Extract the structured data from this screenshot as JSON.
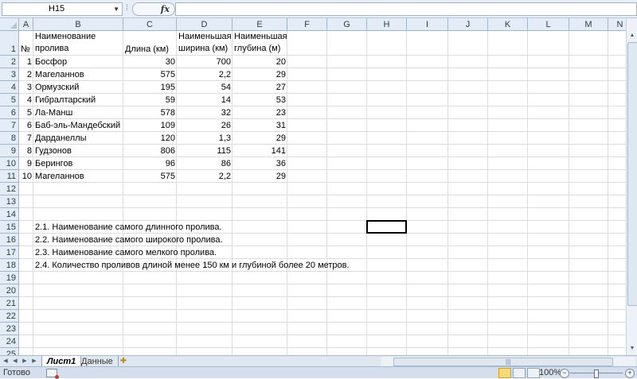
{
  "formula_bar": {
    "name_box": "H15",
    "fx_label": "fx",
    "formula": ""
  },
  "columns": [
    "A",
    "B",
    "C",
    "D",
    "E",
    "F",
    "G",
    "H",
    "I",
    "J",
    "K",
    "L",
    "M",
    "N"
  ],
  "header_row": {
    "a": "№",
    "b": "Наименование пролива",
    "c": "Длина (км)",
    "d": "Наименьшая ширина (км)",
    "e": "Наименьшая глубина (м)"
  },
  "rows": [
    {
      "a": "1",
      "b": "Босфор",
      "c": "30",
      "d": "700",
      "e": "20"
    },
    {
      "a": "2",
      "b": "Магеланнов",
      "c": "575",
      "d": "2,2",
      "e": "29"
    },
    {
      "a": "3",
      "b": "Ормузский",
      "c": "195",
      "d": "54",
      "e": "27"
    },
    {
      "a": "4",
      "b": "Гибралтарский",
      "c": "59",
      "d": "14",
      "e": "53"
    },
    {
      "a": "5",
      "b": "Ла-Манш",
      "c": "578",
      "d": "32",
      "e": "23"
    },
    {
      "a": "6",
      "b": "Баб-эль-Мандебский",
      "c": "109",
      "d": "26",
      "e": "31"
    },
    {
      "a": "7",
      "b": "Дарданеллы",
      "c": "120",
      "d": "1,3",
      "e": "29"
    },
    {
      "a": "8",
      "b": "Гудзонов",
      "c": "806",
      "d": "115",
      "e": "141"
    },
    {
      "a": "9",
      "b": "Берингов",
      "c": "96",
      "d": "86",
      "e": "36"
    },
    {
      "a": "10",
      "b": "Магеланнов",
      "c": "575",
      "d": "2,2",
      "e": "29"
    }
  ],
  "tasks": [
    "2.1. Наименование самого длинного пролива.",
    "2.2. Наименование самого широкого пролива.",
    "2.3. Наименование самого мелкого пролива.",
    "2.4. Количество проливов длиной менее 150 км и глубиной более 20 метров."
  ],
  "row_numbers": [
    "1",
    "2",
    "3",
    "4",
    "5",
    "6",
    "7",
    "8",
    "9",
    "10",
    "11",
    "12",
    "13",
    "14",
    "15",
    "16",
    "17",
    "18",
    "19",
    "20",
    "21",
    "22",
    "23",
    "24",
    "25"
  ],
  "sheet_tabs": [
    "Лист1",
    "Данные"
  ],
  "status": {
    "text": "Готово",
    "zoom": "100%",
    "zoom_minus": "−",
    "zoom_plus": "+"
  },
  "icons": {
    "namebox_dropdown": "chevron-down-icon",
    "new_sheet": "insert-sheet-icon",
    "macro": "macro-record-icon"
  }
}
